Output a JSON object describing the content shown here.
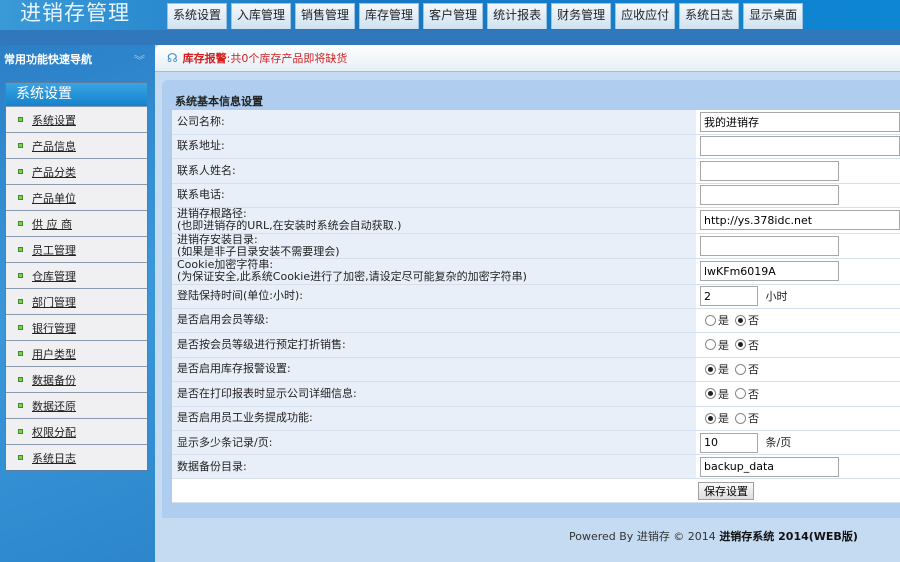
{
  "header": {
    "logo": "进销存管理",
    "tabs": [
      "系统设置",
      "入库管理",
      "销售管理",
      "库存管理",
      "客户管理",
      "统计报表",
      "财务管理",
      "应收应付",
      "系统日志",
      "显示桌面"
    ]
  },
  "sidebar": {
    "title": "常用功能快速导航",
    "panel_title": "系统设置",
    "items": [
      "系统设置",
      "产品信息",
      "产品分类",
      "产品单位",
      "供 应 商",
      "员工管理",
      "仓库管理",
      "部门管理",
      "银行管理",
      "用户类型",
      "数据备份",
      "数据还原",
      "权限分配",
      "系统日志"
    ]
  },
  "alert": {
    "label": "库存报警",
    "text": ":共0个库存产品即将缺货"
  },
  "form": {
    "title": "系统基本信息设置",
    "company_label": "公司名称:",
    "company_value": "我的进销存",
    "address_label": "联系地址:",
    "address_value": "",
    "contact_label": "联系人姓名:",
    "contact_value": "",
    "phone_label": "联系电话:",
    "phone_value": "",
    "root_label": "进销存根路径:",
    "root_hint": "(也即进销存的URL,在安装时系统会自动获取.)",
    "root_value": "http://ys.378idc.net",
    "dir_label": "进销存安装目录:",
    "dir_hint": "(如果是非子目录安装不需要理会)",
    "dir_value": "",
    "cookie_label": "Cookie加密字符串:",
    "cookie_hint": "(为保证安全,此系统Cookie进行了加密,请设定尽可能复杂的加密字符串)",
    "cookie_value": "lwKFm6019A",
    "login_label": "登陆保持时间(单位:小时):",
    "login_value": "2",
    "login_unit": "小时",
    "yes": "是",
    "no": "否",
    "radios": [
      {
        "label": "是否启用会员等级:",
        "value": "否"
      },
      {
        "label": "是否按会员等级进行预定打折销售:",
        "value": "否"
      },
      {
        "label": "是否启用库存报警设置:",
        "value": "是"
      },
      {
        "label": "是否在打印报表时显示公司详细信息:",
        "value": "是"
      },
      {
        "label": "是否启用员工业务提成功能:",
        "value": "是"
      }
    ],
    "perpage_label": "显示多少条记录/页:",
    "perpage_value": "10",
    "perpage_unit": "条/页",
    "backup_label": "数据备份目录:",
    "backup_value": "backup_data",
    "save_label": "保存设置"
  },
  "footer": {
    "powered": "Powered By 进销存 © 2014 ",
    "product": "进销存系统 2014(WEB版)"
  }
}
